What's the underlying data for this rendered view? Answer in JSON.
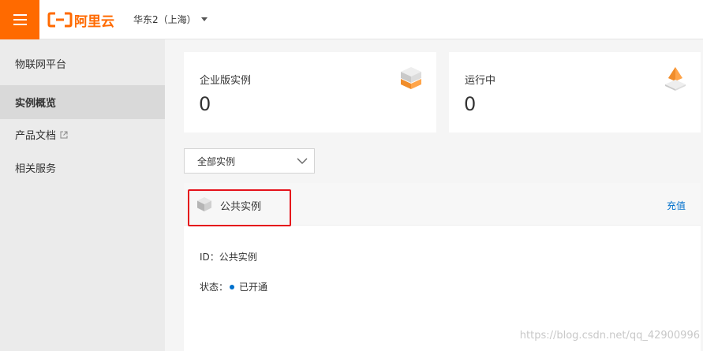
{
  "header": {
    "menu_icon": "hamburger-icon",
    "logo_text": "阿里云",
    "region": "华东2（上海）"
  },
  "sidebar": {
    "title": "物联网平台",
    "items": [
      {
        "label": "实例概览",
        "active": true
      },
      {
        "label": "产品文档",
        "external": true
      },
      {
        "label": "相关服务"
      }
    ]
  },
  "stats": [
    {
      "label": "企业版实例",
      "value": "0",
      "icon": "enterprise-instance-icon"
    },
    {
      "label": "运行中",
      "value": "0",
      "icon": "running-instance-icon"
    }
  ],
  "filter": {
    "selected": "全部实例",
    "icon": "chevron-down-icon"
  },
  "instance": {
    "name": "公共实例",
    "action": "充值",
    "id_label": "ID：",
    "id_value": "公共实例",
    "status_label": "状态：",
    "status_value": "已开通"
  },
  "watermark": "https://blog.csdn.net/qq_42900996",
  "colors": {
    "brand": "#ff6a00",
    "link": "#0070cc",
    "highlight": "#e5121b"
  }
}
